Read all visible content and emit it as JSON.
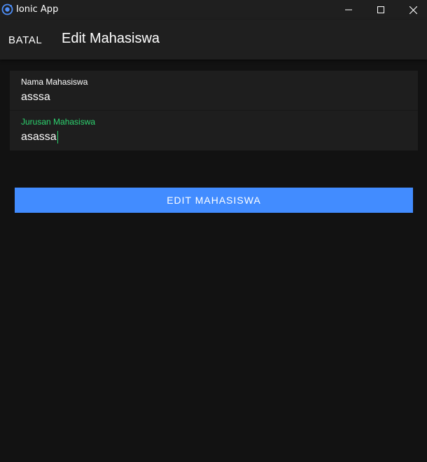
{
  "window": {
    "title": "Ionic App",
    "icon": "ionic-logo-icon",
    "controls": [
      "minimize-icon",
      "maximize-icon",
      "close-icon"
    ]
  },
  "header": {
    "cancel_label": "BATAL",
    "title": "Edit Mahasiswa"
  },
  "form": {
    "fields": [
      {
        "label": "Nama Mahasiswa",
        "value": "asssa",
        "focused": false
      },
      {
        "label": "Jurusan Mahasiswa",
        "value": "asassa",
        "focused": true
      }
    ]
  },
  "submit": {
    "label": "EDIT MAHASISWA"
  },
  "colors": {
    "background": "#121212",
    "toolbar": "#1f1f1f",
    "item": "#1e1e1e",
    "primary": "#428cff",
    "focus": "#2dd36f"
  }
}
